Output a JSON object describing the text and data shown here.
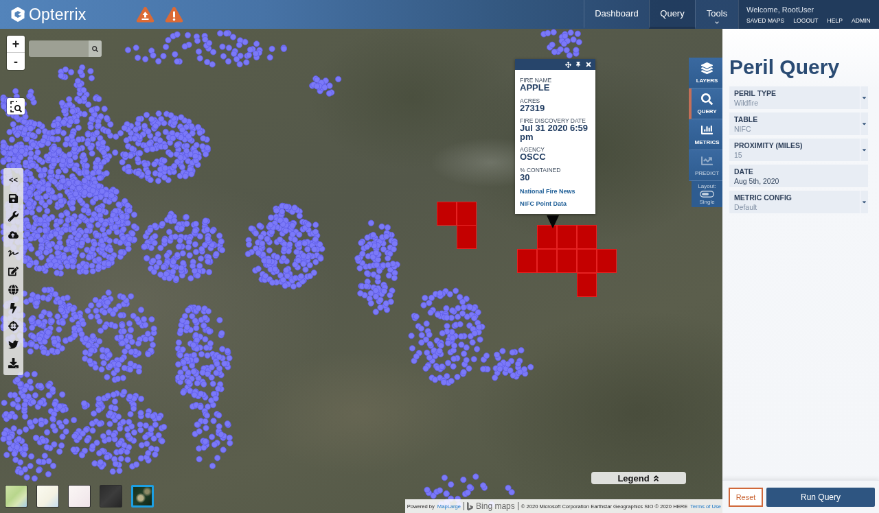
{
  "header": {
    "logo": "Opterrix",
    "nav": [
      {
        "label": "Dashboard",
        "kind": "link",
        "selected": false
      },
      {
        "label": "Query",
        "kind": "link",
        "selected": true
      },
      {
        "label": "Tools",
        "kind": "menu",
        "selected": false
      }
    ],
    "user": {
      "welcome": "Welcome, RootUser",
      "links": [
        "SAVED MAPS",
        "LOGOUT",
        "HELP",
        "ADMIN"
      ]
    }
  },
  "map": {
    "zoom": {
      "in": "+",
      "out": "-"
    },
    "toolbar": {
      "collapse": "<<"
    },
    "popup": {
      "fields": [
        {
          "label": "FIRE NAME",
          "value": "APPLE"
        },
        {
          "label": "ACRES",
          "value": "27319"
        },
        {
          "label": "FIRE DISCOVERY DATE",
          "value": "Jul 31 2020 6:59 pm"
        },
        {
          "label": "AGENCY",
          "value": "OSCC"
        },
        {
          "label": "% CONTAINED",
          "value": "30"
        }
      ],
      "links": [
        "National Fire News",
        "NIFC Point Data"
      ]
    },
    "side_tabs": [
      {
        "label": "LAYERS",
        "selected": false,
        "disabled": false
      },
      {
        "label": "QUERY",
        "selected": true,
        "disabled": false
      },
      {
        "label": "METRICS",
        "selected": false,
        "disabled": false
      },
      {
        "label": "PREDICT",
        "selected": false,
        "disabled": true
      }
    ],
    "layout": {
      "label": "Layout:",
      "value": "Single"
    },
    "legend": "Legend",
    "basemaps": [
      {
        "kind": "terrain",
        "selected": false
      },
      {
        "kind": "street",
        "selected": false
      },
      {
        "kind": "light",
        "selected": false
      },
      {
        "kind": "dark",
        "selected": false
      },
      {
        "kind": "satellite",
        "selected": true
      }
    ],
    "attribution": {
      "prefix": "Powered by",
      "provider_link": "MapLarge",
      "logo_text": "Bing maps",
      "copyright": "© 2020 Microsoft Corporation Earthstar Geographics SIO © 2020 HERE",
      "terms_link": "Terms of Use"
    }
  },
  "panel": {
    "title": "Peril Query",
    "fields": [
      {
        "label": "PERIL TYPE",
        "value": "Wildfire",
        "kind": "dropdown"
      },
      {
        "label": "TABLE",
        "value": "NIFC",
        "kind": "dropdown"
      },
      {
        "label": "PROXIMITY (MILES)",
        "value": "15",
        "kind": "dropdown"
      },
      {
        "label": "DATE",
        "value": "Aug 5th, 2020",
        "kind": "date"
      },
      {
        "label": "METRIC CONFIG",
        "value": "Default",
        "kind": "dropdown"
      }
    ],
    "buttons": {
      "reset": "Reset",
      "run": "Run Query"
    }
  }
}
